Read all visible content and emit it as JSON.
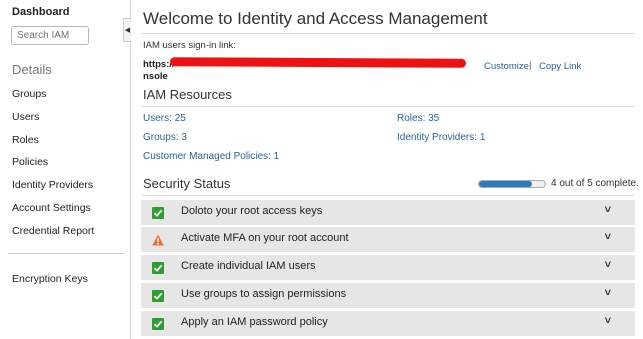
{
  "sidebar": {
    "title": "Dashboard",
    "search_placeholder": "Search IAM",
    "section": "Details",
    "items": [
      {
        "label": "Groups"
      },
      {
        "label": "Users"
      },
      {
        "label": "Roles"
      },
      {
        "label": "Policies"
      },
      {
        "label": "Identity Providers"
      },
      {
        "label": "Account Settings"
      },
      {
        "label": "Credential Report"
      }
    ],
    "extra_items": [
      {
        "label": "Encryption Keys"
      }
    ]
  },
  "main": {
    "title": "Welcome to Identity and Access Management",
    "signin": {
      "label": "IAM users sign-in link:",
      "url_prefix": "https://",
      "url_suffix": "nsole",
      "customize_label": "Customize",
      "separator": "|",
      "copy_label": "Copy Link"
    },
    "resources": {
      "title": "IAM Resources",
      "users": "Users: 25",
      "roles": "Roles: 35",
      "groups": "Groups: 3",
      "identity_providers": "Identity Providers: 1",
      "customer_policies": "Customer Managed Policies: 1"
    },
    "security": {
      "title": "Security Status",
      "progress_fraction": 0.8,
      "progress_text": "4 out of 5 complete.",
      "items": [
        {
          "label": "Doloto your root access keys",
          "status": "complete"
        },
        {
          "label": "Activate MFA on your root account",
          "status": "warning"
        },
        {
          "label": "Create individual IAM users",
          "status": "complete"
        },
        {
          "label": "Use groups to assign permissions",
          "status": "complete"
        },
        {
          "label": "Apply an IAM password policy",
          "status": "complete"
        }
      ]
    }
  },
  "colors": {
    "link": "#2a6496",
    "check_green": "#2e9e2e",
    "warning_orange": "#e8742a",
    "progress_blue": "#2b7bbf",
    "row_bg": "#e6e6e6"
  }
}
